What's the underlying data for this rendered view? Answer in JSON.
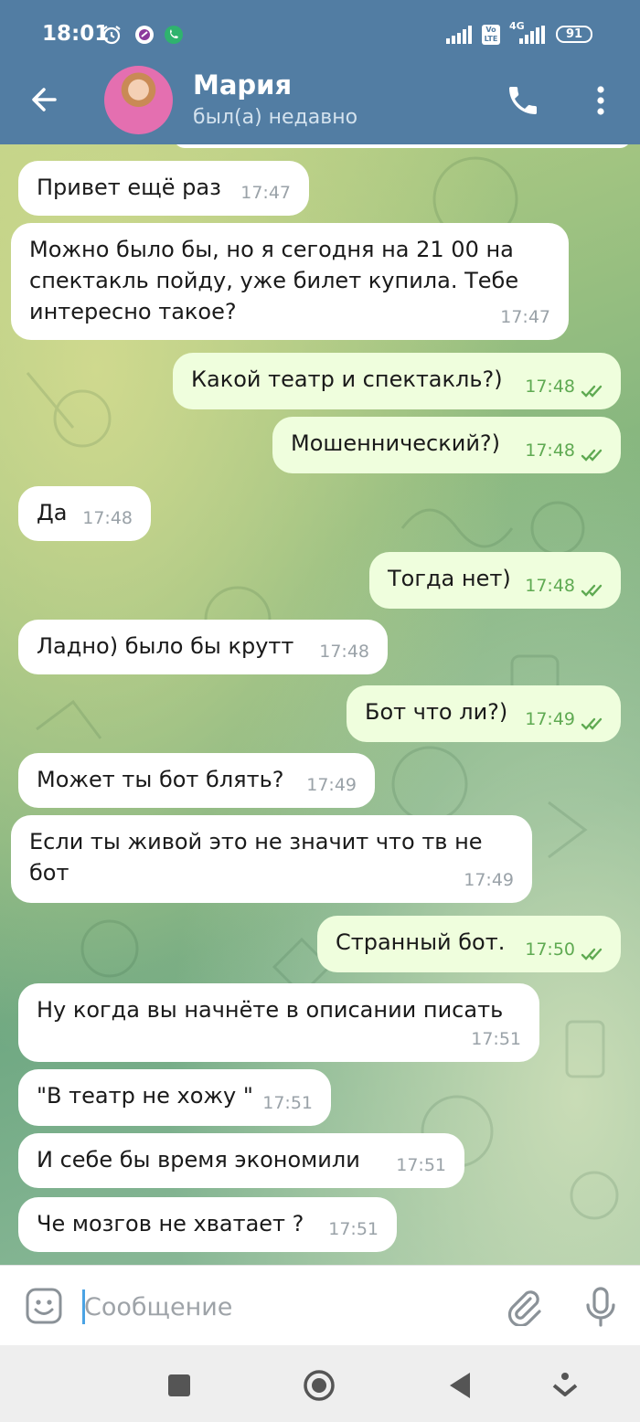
{
  "status_bar": {
    "time": "18:01",
    "battery": "91",
    "network": "4G"
  },
  "header": {
    "name": "Мария",
    "status": "был(а) недавно"
  },
  "messages": [
    {
      "dir": "in",
      "text": "Привет ещё раз",
      "time": "17:47"
    },
    {
      "dir": "in",
      "text": "Можно было бы, но я сегодня на 21 00 на\nспектакль пойду, уже билет купила. Тебе\nинтересно такое?",
      "time": "17:47"
    },
    {
      "dir": "out",
      "text": "Какой театр и спектакль?)",
      "time": "17:48"
    },
    {
      "dir": "out",
      "text": "Мошеннический?)",
      "time": "17:48"
    },
    {
      "dir": "in",
      "text": "Да",
      "time": "17:48"
    },
    {
      "dir": "out",
      "text": "Тогда нет)",
      "time": "17:48"
    },
    {
      "dir": "in",
      "text": "Ладно) было бы крутт",
      "time": "17:48"
    },
    {
      "dir": "out",
      "text": "Бот что ли?)",
      "time": "17:49"
    },
    {
      "dir": "in",
      "text": "Может ты бот блять?",
      "time": "17:49"
    },
    {
      "dir": "in",
      "text": "Если ты живой это не значит что тв не\nбот",
      "time": "17:49"
    },
    {
      "dir": "out",
      "text": "Странный бот.",
      "time": "17:50"
    },
    {
      "dir": "in",
      "text": "Ну когда вы начнёте в описании писать",
      "time": "17:51"
    },
    {
      "dir": "in",
      "text": "\"В театр не хожу \"",
      "time": "17:51"
    },
    {
      "dir": "in",
      "text": "И себе бы время экономили",
      "time": "17:51"
    },
    {
      "dir": "in",
      "text": "Че мозгов не хватает ?",
      "time": "17:51"
    }
  ],
  "input": {
    "placeholder": "Сообщение"
  },
  "colors": {
    "header": "#527da3",
    "incoming": "#ffffff",
    "outgoing": "#effedd",
    "time_out": "#5faa52",
    "time_in": "#9aa2a8"
  },
  "icons": [
    "alarm-icon",
    "app-icon",
    "phone-status-icon",
    "signal-icon",
    "back-arrow-icon",
    "phone-icon",
    "more-vert-icon",
    "double-check-icon",
    "emoji-icon",
    "attach-icon",
    "mic-icon",
    "recents-icon",
    "home-icon",
    "back-nav-icon",
    "accessibility-icon"
  ]
}
